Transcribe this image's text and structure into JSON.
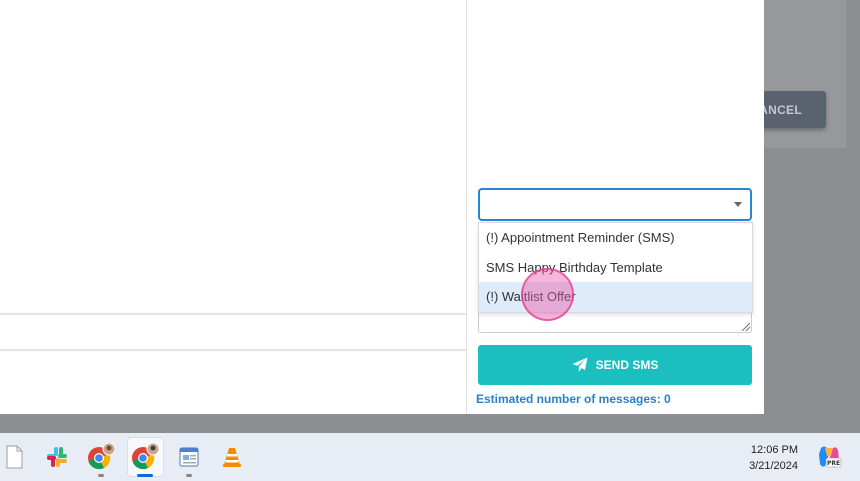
{
  "background": {
    "cancel_label": "ANCEL"
  },
  "sms_modal": {
    "template_select": {
      "value": ""
    },
    "template_options": [
      {
        "label": "(!) Appointment Reminder (SMS)",
        "highlighted": false
      },
      {
        "label": "SMS Happy Birthday Template",
        "highlighted": false
      },
      {
        "label": "(!) Waitlist Offer",
        "highlighted": true
      }
    ],
    "send_button_label": "SEND SMS",
    "estimate_text": "Estimated number of messages: 0"
  },
  "taskbar": {
    "icons": [
      {
        "name": "file-icon"
      },
      {
        "name": "slack-icon"
      },
      {
        "name": "chrome-profile-icon"
      },
      {
        "name": "chrome-profile-icon-active"
      },
      {
        "name": "app-window-icon"
      },
      {
        "name": "vlc-icon"
      }
    ],
    "time": "12:06 PM",
    "date": "3/21/2024",
    "copilot_badge": "PRE"
  },
  "colors": {
    "accent": "#1bbfbf",
    "link": "#2a80c8",
    "select_border": "#2684d9",
    "highlight": "#deebfb"
  }
}
